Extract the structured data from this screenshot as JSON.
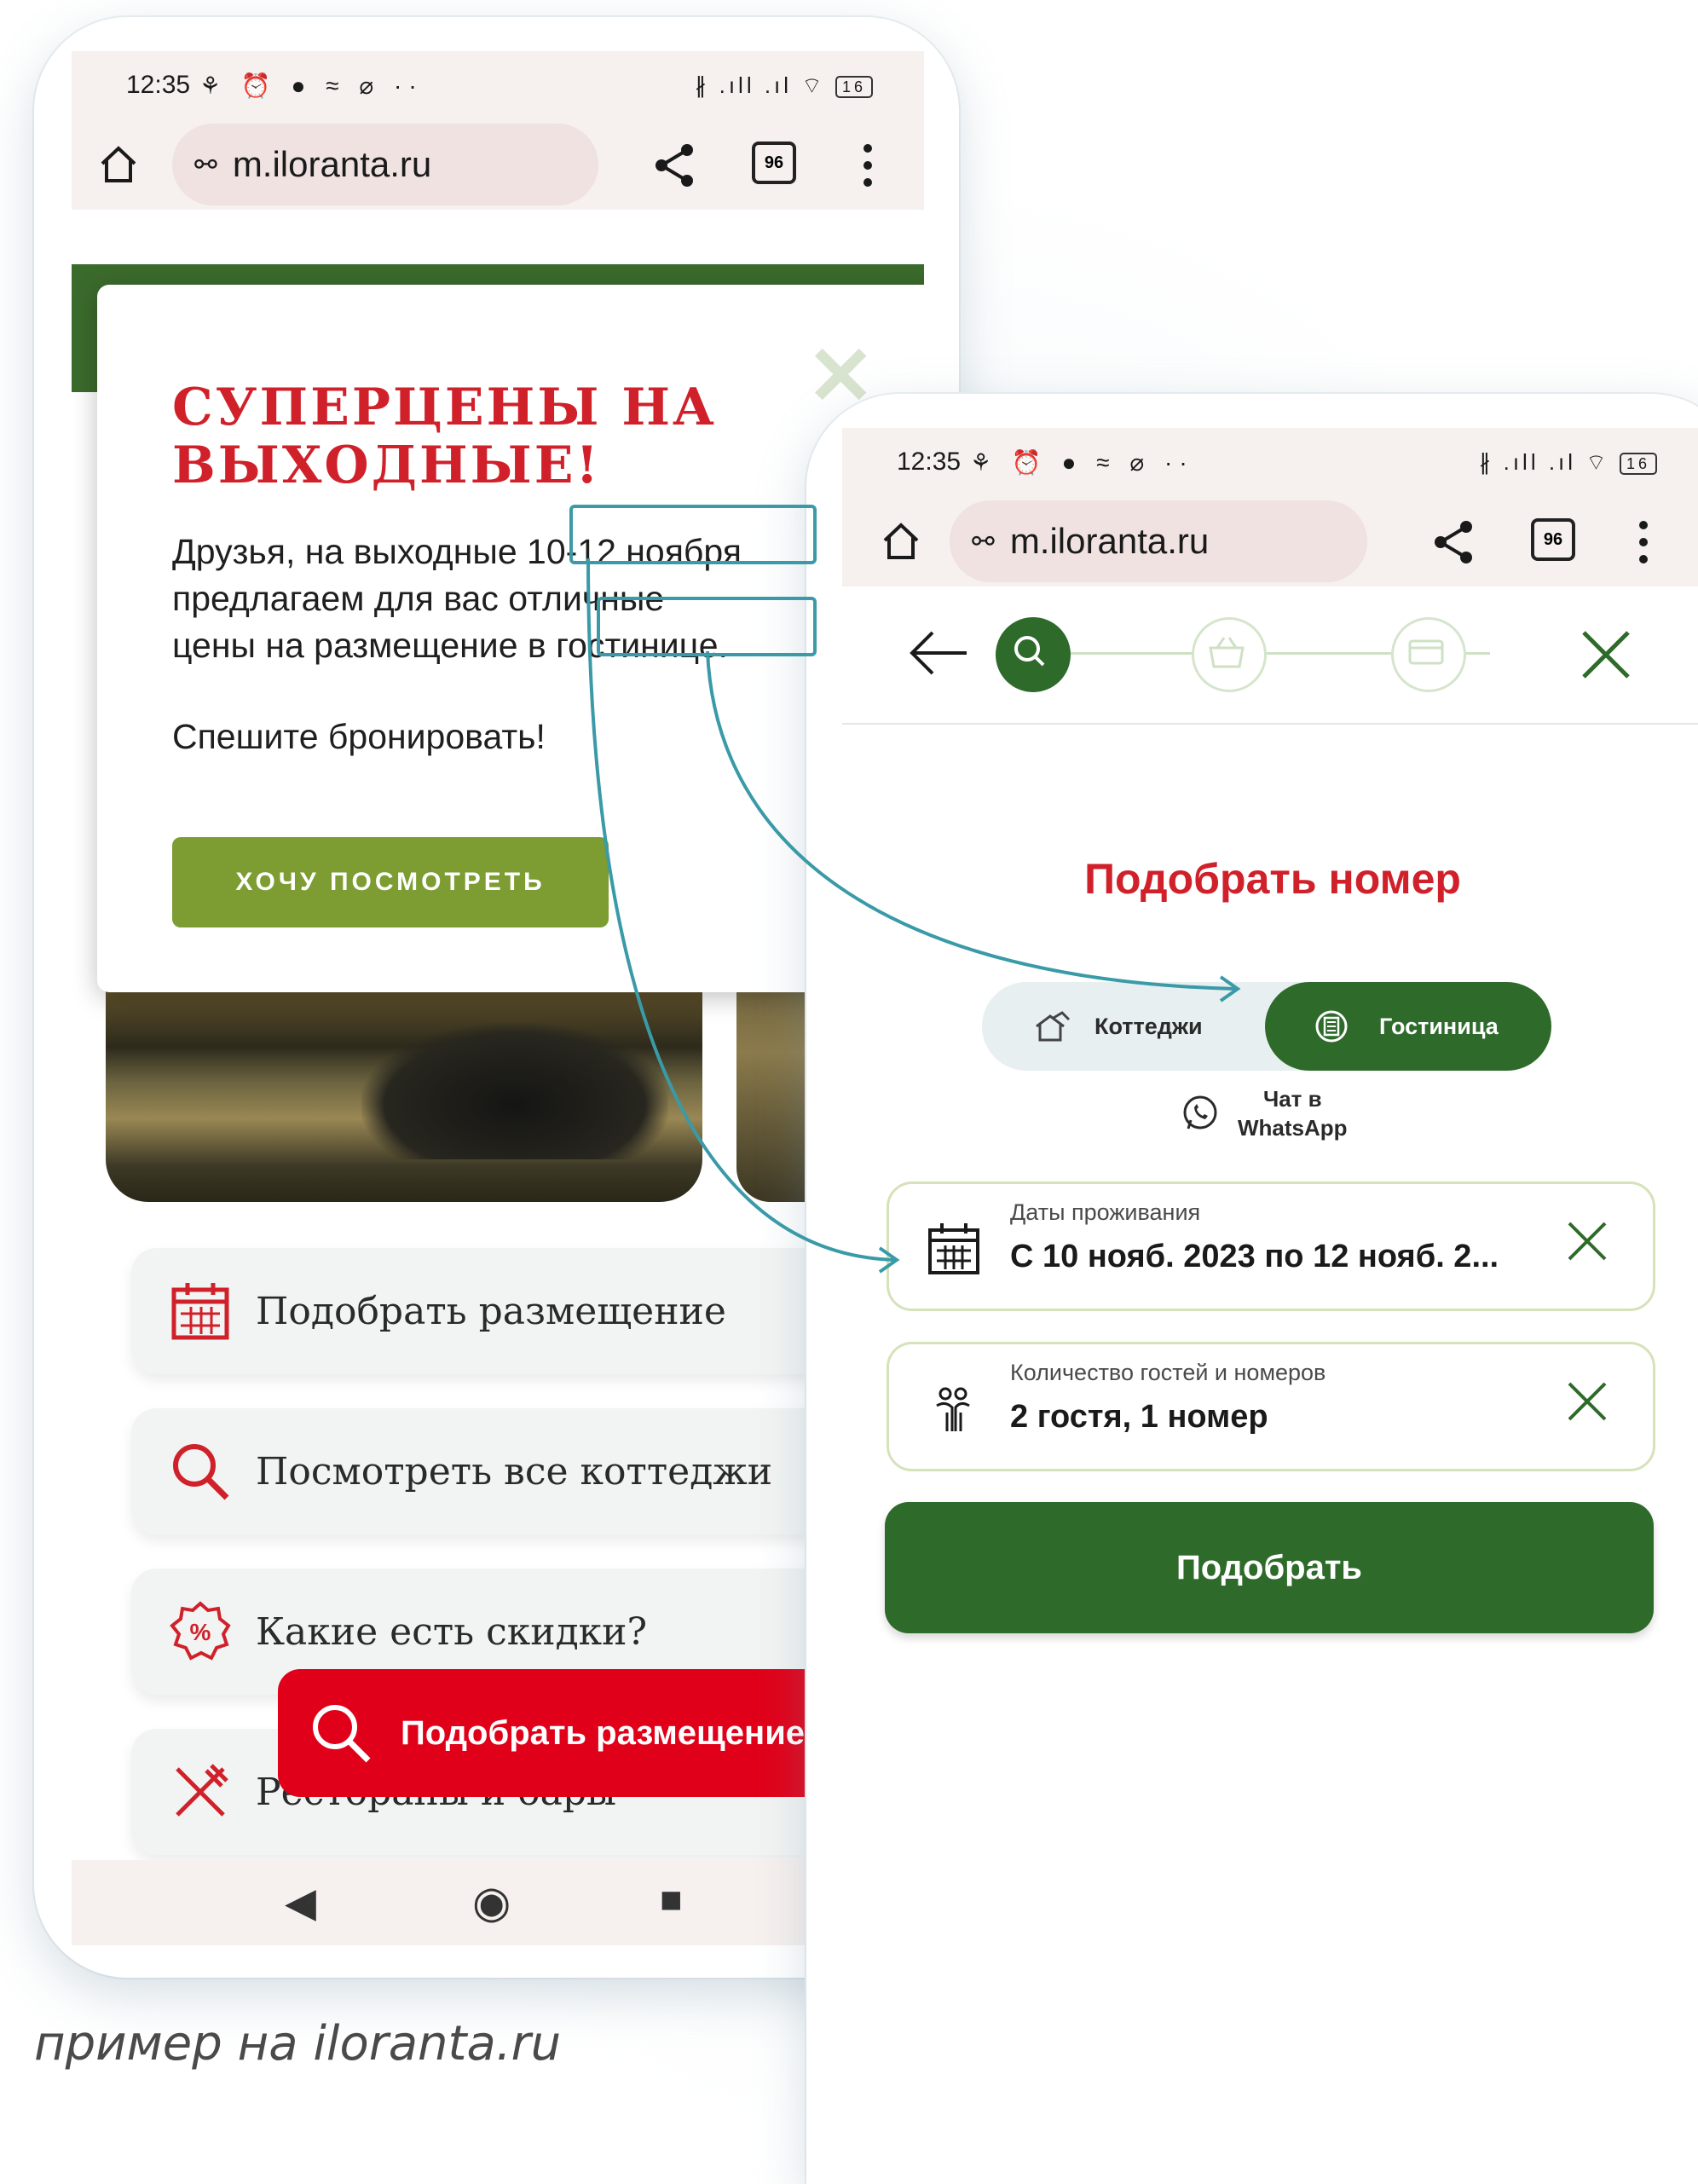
{
  "caption": "пример на iloranta.ru",
  "left_phone": {
    "status": {
      "time": "12:35",
      "icons_left": "⚘ ⏰ ● ≈ ⌀ ··",
      "icons_right": "∦ .ıll .ıl ⌔",
      "battery": "16"
    },
    "browser": {
      "url": "m.iloranta.ru",
      "tabs_count": "96"
    },
    "popup": {
      "title_line1": "СУПЕРЦЕНЫ НА",
      "title_line2": "ВЫХОДНЫЕ!",
      "text_line1_a": "Друзья, на выходные ",
      "text_line1_b": "10-12 ноября",
      "text_line2": "предлагаем для вас отличные",
      "text_line3_a": "цены на размещение в ",
      "text_line3_b": "гостинице.",
      "text_line4": "Спешите бронировать!",
      "button": "ХОЧУ ПОСМОТРЕТЬ",
      "close": "✕"
    },
    "menu": [
      {
        "label": "Подобрать размещение",
        "icon": "calendar-icon"
      },
      {
        "label": "Посмотреть все коттеджи",
        "icon": "search-icon",
        "chevron": "⌄"
      },
      {
        "label": "Какие есть скидки?",
        "icon": "discount-icon"
      },
      {
        "label": "Рестораны и бары",
        "icon": "restaurant-icon"
      }
    ],
    "fab": {
      "label": "Подобрать размещение",
      "icon": "search-icon"
    },
    "navbar": {
      "back": "◀",
      "home": "◉",
      "recents": "■"
    }
  },
  "right_phone": {
    "status": {
      "time": "12:35",
      "icons_left": "⚘ ⏰ ● ≈ ⌀ ··",
      "icons_right": "∦ .ıll .ıl ⌔",
      "battery": "16"
    },
    "browser": {
      "url": "m.iloranta.ru",
      "tabs_count": "96"
    },
    "title": "Подобрать номер",
    "toggle": {
      "cottages": "Коттеджи",
      "hotel": "Гостиница",
      "active": "hotel"
    },
    "whatsapp": {
      "line1": "Чат в",
      "line2": "WhatsApp"
    },
    "dates_field": {
      "label": "Даты проживания",
      "value": "С 10 нояб. 2023 по 12 нояб. 2..."
    },
    "guests_field": {
      "label": "Количество гостей и номеров",
      "value": "2 гостя, 1 номер"
    },
    "submit": "Подобрать"
  },
  "colors": {
    "brand_green": "#2e6a2a",
    "accent_red": "#d0212b",
    "highlight_teal": "#3a9aa7",
    "olive_button": "#7d9c32"
  }
}
